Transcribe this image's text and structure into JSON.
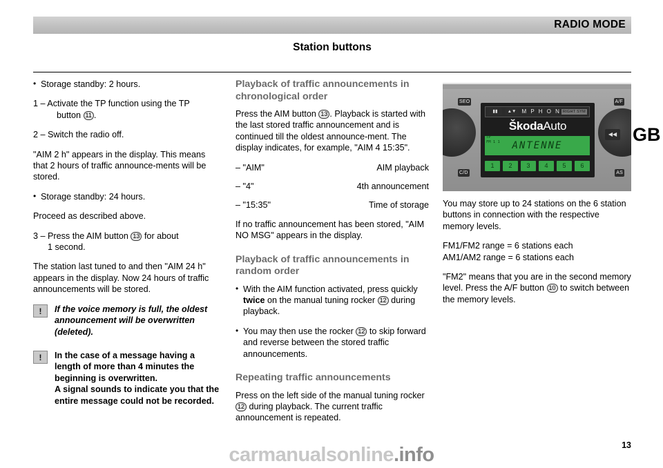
{
  "header": {
    "mode_title": "RADIO MODE",
    "section_title": "Station buttons"
  },
  "lang_tab": "GB",
  "column1": {
    "storage_standby_2h": "Storage standby: 2 hours.",
    "step1_text": "1 – Activate the TP function using the TP",
    "step1_cont": "button",
    "step1_num": "11",
    "step1_end": ".",
    "step2": "2 – Switch the radio off.",
    "aim2h_para": "\"AIM 2 h\" appears in the display. This means that 2 hours of traffic announce-ments will be stored.",
    "storage_standby_24h": "Storage standby: 24 hours.",
    "proceed": "Proceed as described above.",
    "step3_text": "3 – Press the AIM button",
    "step3_num": "13",
    "step3_tail": "for about",
    "step3_cont": "1 second.",
    "last_tuned_para": "The station last tuned to and then \"AIM 24 h\" appears in the display. Now 24 hours of traffic announcements will be stored.",
    "note1": "If the voice memory is full, the oldest announcement will be overwritten (deleted).",
    "note2": "In the case of a message having a length of more than 4 minutes the beginning is overwritten.\nA signal sounds to indicate you that the entire message could not be recorded."
  },
  "column2": {
    "heading_chrono": "Playback of traffic announcements in chronological order",
    "chrono_p1_a": "Press the AIM button",
    "chrono_p1_num": "13",
    "chrono_p1_b": ". Playback is started with the last stored traffic announcement and is continued till the oldest announce-ment. The display indicates, for example, \"AIM 4 15:35\".",
    "def_rows": [
      {
        "term": "– \"AIM\"",
        "desc": "AIM playback"
      },
      {
        "term": "– \"4\"",
        "desc": "4th announcement"
      },
      {
        "term": "– \"15:35\"",
        "desc": "Time of storage"
      }
    ],
    "no_msg": "If no traffic announcement has been stored, \"AIM NO MSG\" appears in the display.",
    "heading_random": "Playback of traffic announcements in random order",
    "random_b1_a": "With the AIM function activated, press quickly",
    "random_b1_bold": "twice",
    "random_b1_b": "on the manual tuning rocker",
    "random_b1_num": "12",
    "random_b1_c": "during playback.",
    "random_b2_a": "You may then use the rocker",
    "random_b2_num": "12",
    "random_b2_b": "to skip forward and reverse between the stored traffic announcements.",
    "heading_repeating": "Repeating traffic announcements",
    "repeating_a": "Press on the left side of the manual tuning rocker",
    "repeating_num": "12",
    "repeating_b": "during playback. The current traffic announcement is repeated."
  },
  "column3": {
    "radio": {
      "label_seo": "SEO",
      "label_af": "A/F",
      "label_cd": "C/D",
      "label_as": "AS",
      "label_sym": "S Y M P H O N Y",
      "label_right_tag": "RIGHT SYM",
      "brand_bold": "Škoda",
      "brand_light": "Auto",
      "display_text": "ANTENNE",
      "display_line1": "TP",
      "display_line2": "FM 1 1",
      "rocker_left": "▮▮",
      "rocker_right": "▲▼",
      "arrow_btn": "◀◀",
      "presets": [
        "1",
        "2",
        "3",
        "4",
        "5",
        "6"
      ]
    },
    "p1": "You may store up to 24 stations on the 6 station buttons in connection with the respective memory levels.",
    "p2_line1": "FM1/FM2 range = 6 stations each",
    "p2_line2": "AM1/AM2 range = 6 stations each",
    "p3_a": "\"FM2\" means that you are in the second memory level. Press the A/F button",
    "p3_num": "10",
    "p3_b": "to switch between the memory levels."
  },
  "footer": {
    "page_number": "13",
    "watermark_light": "carmanualsonline",
    "watermark_dark": ".info"
  }
}
